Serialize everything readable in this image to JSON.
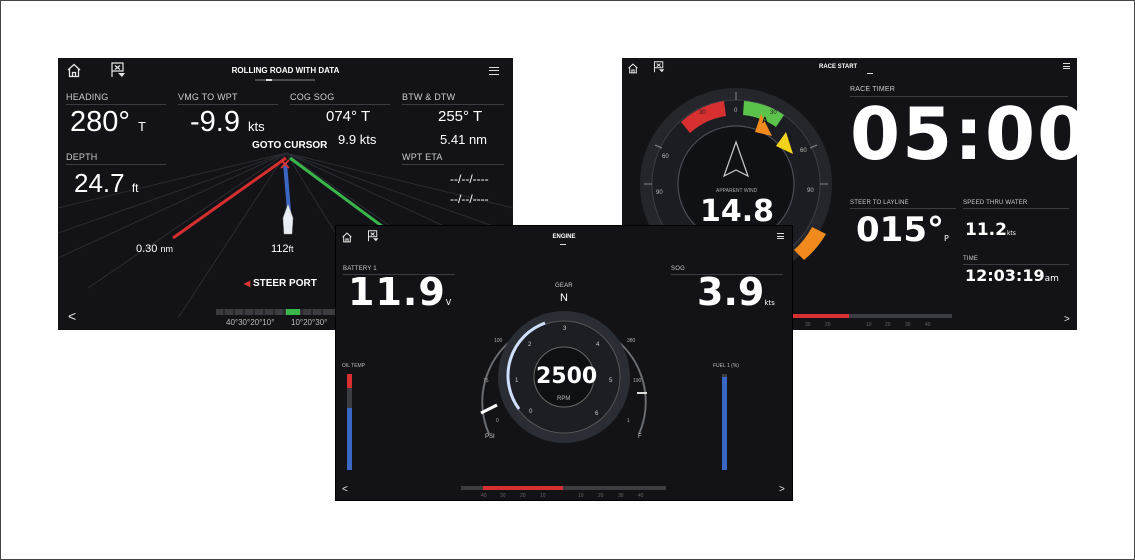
{
  "s1": {
    "title": "ROLLING ROAD WITH DATA",
    "heading": {
      "label": "HEADING",
      "value": "280°",
      "unit": "T"
    },
    "vmg": {
      "label": "VMG TO WPT",
      "value": "-9.9",
      "unit": "kts"
    },
    "cogsog": {
      "label": "COG SOG",
      "cog": "074°",
      "cog_unit": "T",
      "sog": "9.9",
      "sog_unit": "kts"
    },
    "btw": {
      "label": "BTW & DTW",
      "btw": "255°",
      "btw_unit": "T",
      "dtw": "5.41",
      "dtw_unit": "nm"
    },
    "depth": {
      "label": "DEPTH",
      "value": "24.7",
      "unit": "ft"
    },
    "wpt_eta": {
      "label": "WPT ETA",
      "line1": "--/--/----",
      "line2": "--/--/----"
    },
    "goto": "GOTO CURSOR",
    "dist_left": {
      "value": "0.30",
      "unit": "nm"
    },
    "dist_mid": {
      "value": "112",
      "unit": "ft"
    },
    "steer": "STEER PORT",
    "scale_left": "40°30°20°10°",
    "scale_right": "10°20°30°"
  },
  "s2": {
    "title": "RACE START",
    "race_timer_label": "RACE  TIMER",
    "timer": "05:00",
    "apparent_wind_label": "APPARENT WIND",
    "apparent_wind": "14.8",
    "dial_labels": [
      "0",
      "30",
      "60",
      "90",
      "30",
      "60",
      "90",
      "120"
    ],
    "steer_layline": {
      "label": "STEER TO LAYLINE",
      "value": "015°",
      "unit": "P"
    },
    "stw": {
      "label": "SPEED THRU WATER",
      "value": "11.2",
      "unit": "kts"
    },
    "time": {
      "label": "TIME",
      "value": "12:03:19",
      "unit": "am"
    },
    "marker_a": "A",
    "marker_t": "T",
    "scale": [
      "30",
      "20",
      "10",
      "10",
      "20",
      "30",
      "40"
    ]
  },
  "s3": {
    "title": "ENGINE",
    "battery": {
      "label": "BATTERY 1",
      "value": "11.9",
      "unit": "V"
    },
    "gear": {
      "label": "GEAR",
      "value": "N"
    },
    "sog": {
      "label": "SOG",
      "value": "3.9",
      "unit": "kts"
    },
    "rpm": {
      "value": "2500",
      "unit": "RPM"
    },
    "rpm_ticks": [
      "0",
      "1",
      "2",
      "3",
      "4",
      "5",
      "6"
    ],
    "oil_temp_label": "OIL TEMP",
    "fuel_label": "FUEL 1 (%)",
    "psi_label": "PSI",
    "psi_ticks": [
      "100",
      "75",
      "0"
    ],
    "f_label": "F",
    "f_ticks": [
      "380",
      "190",
      "1"
    ],
    "scale": [
      "40",
      "30",
      "20",
      "10",
      "10",
      "20",
      "30",
      "40"
    ]
  },
  "colors": {
    "bg": "#131317",
    "red": "#e03434",
    "green": "#3fbf4a",
    "orange": "#f08a1c",
    "yellow": "#f3d21b",
    "blue": "#3a66c4"
  },
  "icons": [
    "home-icon",
    "waypoint-flag-icon",
    "menu-icon",
    "chevron-left-icon",
    "chevron-right-icon",
    "boat-icon"
  ]
}
